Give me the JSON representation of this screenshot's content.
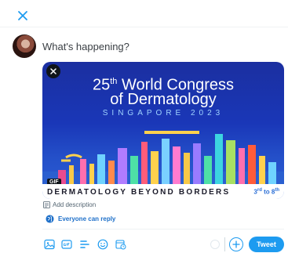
{
  "compose": {
    "placeholder": "What's happening?",
    "value": ""
  },
  "media": {
    "title_number": "25",
    "title_suffix": "th",
    "title_rest": " World Congress",
    "title_line2": "of Dermatology",
    "subtitle": "SINGAPORE 2023",
    "tagline": "DERMATOLOGY BEYOND BORDERS",
    "date_a": "3",
    "date_a_sup": "rd",
    "date_mid": " to 8",
    "date_b_sup": "th",
    "badge": "GIF"
  },
  "description": {
    "label": "Add description"
  },
  "reply": {
    "label": "Everyone can reply"
  },
  "actions": {
    "tweet_label": "Tweet"
  },
  "icons": {
    "close": "close-icon",
    "media_remove": "close-icon",
    "image": "image-icon",
    "gif": "gif-icon",
    "poll": "poll-icon",
    "emoji": "emoji-icon",
    "schedule": "schedule-icon",
    "globe": "globe-icon",
    "add_thread": "plus-circle-icon"
  },
  "colors": {
    "accent": "#1d9bf0",
    "banner": "#1a37b8"
  }
}
